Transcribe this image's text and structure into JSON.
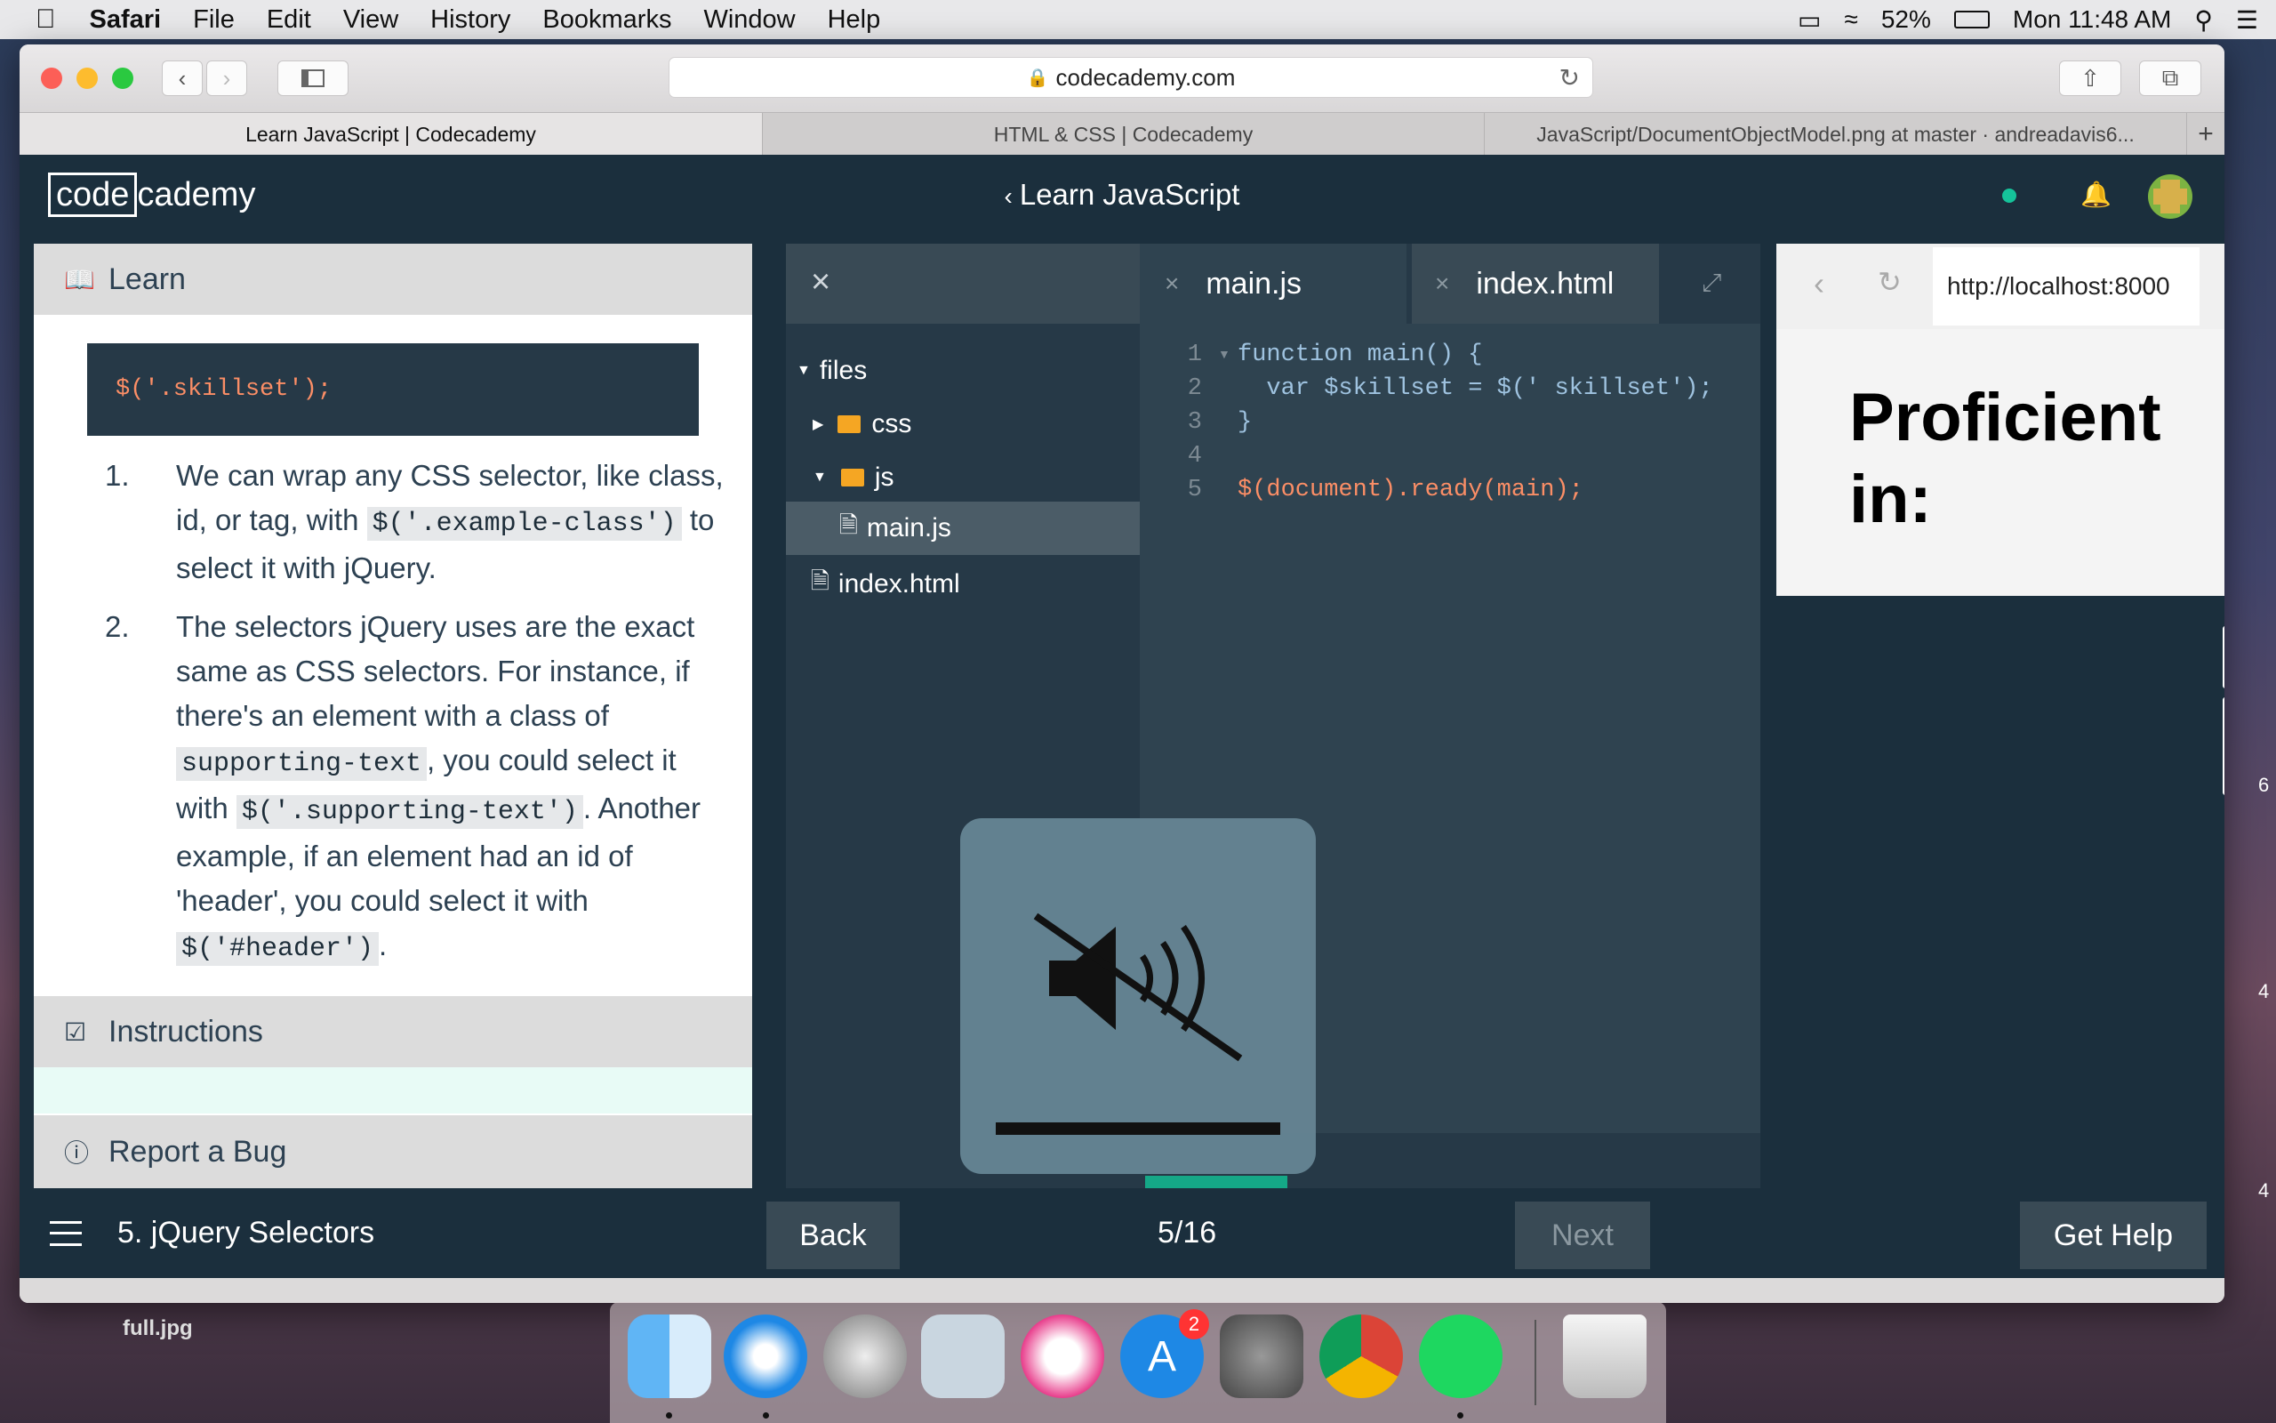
{
  "menubar": {
    "app_name": "Safari",
    "items": [
      "File",
      "Edit",
      "View",
      "History",
      "Bookmarks",
      "Window",
      "Help"
    ],
    "battery": "52%",
    "clock": "Mon 11:48 AM"
  },
  "browser": {
    "url": "codecademy.com",
    "tabs": [
      "Learn JavaScript | Codecademy",
      "HTML & CSS | Codecademy",
      "JavaScript/DocumentObjectModel.png at master · andreadavis6..."
    ]
  },
  "app": {
    "logo_left": "code",
    "logo_right": "cademy",
    "lesson_title": "Learn JavaScript",
    "status_color": "#15c39a"
  },
  "learn": {
    "header": "Learn",
    "code": "$('.skillset');",
    "step1_num": "1.",
    "step1_a": "We can wrap any CSS selector, like class, id, or tag, with ",
    "step1_code": "$('.example-class')",
    "step1_b": " to select it with jQuery.",
    "step2_num": "2.",
    "step2_a": "The selectors jQuery uses are the exact same as CSS selectors. For instance, if there's an element with a class of ",
    "step2_code1": "supporting-text",
    "step2_b": ", you could select it with ",
    "step2_code2": "$('.supporting-text')",
    "step2_c": ". Another example, if an element had an id of 'header', you could select it with ",
    "step2_code3": "$('#header')",
    "step2_d": ".",
    "instructions": "Instructions",
    "report_bug": "Report a Bug"
  },
  "filetree": {
    "root": "files",
    "css": "css",
    "js": "js",
    "main_js": "main.js",
    "index_html": "index.html"
  },
  "editor": {
    "tab1": "main.js",
    "tab2": "index.html",
    "lines": [
      {
        "n": "1",
        "code": "function main() {"
      },
      {
        "n": "2",
        "code": "  var $skillset = $(' skillset');"
      },
      {
        "n": "3",
        "code": "}"
      },
      {
        "n": "4",
        "code": ""
      },
      {
        "n": "5",
        "code": "$(document).ready(main);"
      }
    ]
  },
  "preview": {
    "url": "http://localhost:8000",
    "heading_line1": "Proficient",
    "heading_line2": "in:"
  },
  "footer": {
    "lesson": "5. jQuery Selectors",
    "back": "Back",
    "progress": "5/16",
    "next": "Next",
    "get_help": "Get Help"
  },
  "desktop": {
    "file_label": "full.jpg",
    "dock_badge": "2",
    "side_nums": [
      "6",
      "4",
      "4"
    ]
  }
}
